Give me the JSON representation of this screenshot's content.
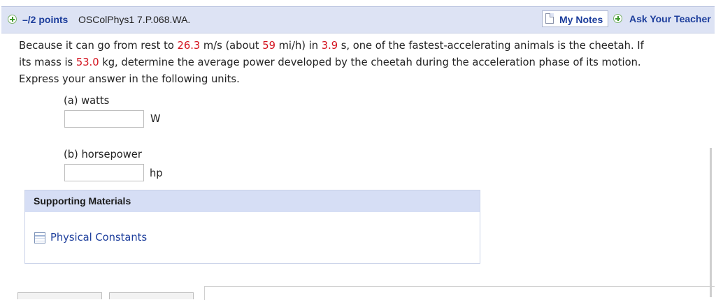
{
  "header": {
    "points": "–/2 points",
    "problem_code": "OSColPhys1 7.P.068.WA.",
    "my_notes_label": "My Notes",
    "ask_teacher_label": "Ask Your Teacher"
  },
  "question": {
    "line1_a": "Because it can go from rest to ",
    "speed_ms": "26.3",
    "line1_b": " m/s (about ",
    "speed_mih": "59",
    "line1_c": " mi/h) in ",
    "time_s": "3.9",
    "line1_d": " s, one of the fastest-accelerating animals is the cheetah. If",
    "line2_a": "its mass is ",
    "mass_kg": "53.0",
    "line2_b": " kg, determine the average power developed by the cheetah during the acceleration phase of its motion.",
    "line3": "Express your answer in the following units."
  },
  "parts": [
    {
      "label": "(a) watts",
      "value": "",
      "unit": "W"
    },
    {
      "label": "(b) horsepower",
      "value": "",
      "unit": "hp"
    }
  ],
  "supporting": {
    "title": "Supporting Materials",
    "link_label": "Physical Constants"
  },
  "colors": {
    "header_bg": "#dde3f4",
    "link_blue": "#1d3e9c",
    "value_red": "#d3111d",
    "support_head_bg": "#d6def5"
  }
}
